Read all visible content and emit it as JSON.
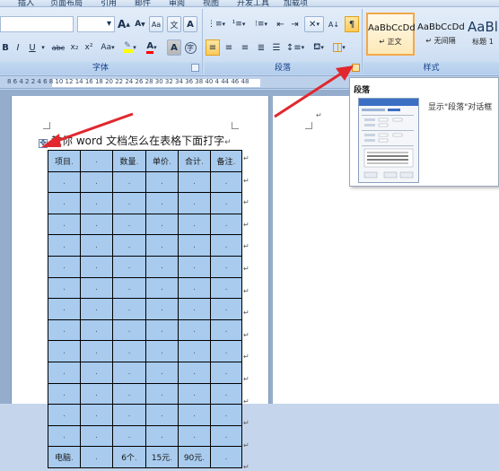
{
  "tabs": [
    "插入",
    "页面布局",
    "引用",
    "邮件",
    "审阅",
    "视图",
    "开发工具",
    "加载项"
  ],
  "font_group": {
    "label": "字体",
    "font_size": "",
    "grow_glyph": "A",
    "shrink_glyph": "A",
    "clear_format_glyph": "Aa",
    "bold": "B",
    "italic": "I",
    "underline": "U",
    "strike": "abc",
    "subscript": "x₂",
    "superscript": "x²",
    "change_case": "Aa",
    "highlight_color": "#ffff00",
    "font_color": "#ff0000",
    "font_color_glyph": "A",
    "char_shade_glyph": "A",
    "enclosed_glyph": "㊢",
    "phonetic_glyph": "文",
    "border_glyph": "A"
  },
  "paragraph_group": {
    "label": "段落"
  },
  "styles_group": {
    "label": "样式",
    "items": [
      {
        "sample": "AaBbCcDd",
        "name": "↵ 正文",
        "selected": true
      },
      {
        "sample": "AaBbCcDd",
        "name": "↵ 无间隔",
        "selected": false
      },
      {
        "sample": "AaBl",
        "name": "标题 1",
        "selected": false
      }
    ]
  },
  "ruler_text": "8  6  4  2     2  4  6  8 10 12 14 16 18 20 22 24 26 28 30 32 34 36 38 40 4   44 46 48",
  "document": {
    "title_prefix": "教你",
    "title": "word 文档怎么在表格下面打字",
    "pilcrow": "↵",
    "table": {
      "headers": [
        "项目",
        "",
        "数量",
        "单价",
        "合计",
        "备注"
      ],
      "rows": [
        [
          "",
          "",
          "",
          "",
          "",
          ""
        ],
        [
          "",
          "",
          "",
          "",
          "",
          ""
        ],
        [
          "",
          "",
          "",
          "",
          "",
          ""
        ],
        [
          "",
          "",
          "",
          "",
          "",
          ""
        ],
        [
          "",
          "",
          "",
          "",
          "",
          ""
        ],
        [
          "",
          "",
          "",
          "",
          "",
          ""
        ],
        [
          "",
          "",
          "",
          "",
          "",
          ""
        ],
        [
          "",
          "",
          "",
          "",
          "",
          ""
        ],
        [
          "",
          "",
          "",
          "",
          "",
          ""
        ],
        [
          "",
          "",
          "",
          "",
          "",
          ""
        ],
        [
          "",
          "",
          "",
          "",
          "",
          ""
        ],
        [
          "",
          "",
          "",
          "",
          "",
          ""
        ],
        [
          "",
          "",
          "",
          "",
          "",
          ""
        ],
        [
          "电脑",
          "",
          "6个",
          "15元",
          "90元",
          ""
        ]
      ]
    }
  },
  "tooltip": {
    "title": "段落",
    "description": "显示\"段落\"对话框"
  },
  "colors": {
    "arrow": "#e0282e",
    "table_fill": "#a8cbee",
    "ribbon_bg": "#d6e4f5",
    "selected_style_border": "#f2a84b"
  }
}
